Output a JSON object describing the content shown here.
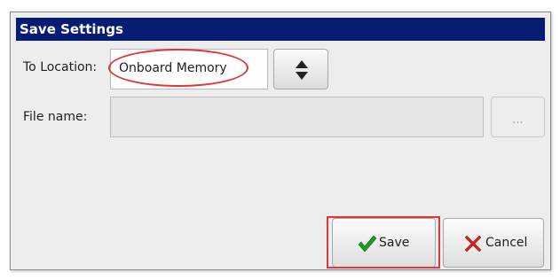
{
  "dialog": {
    "title": "Save Settings"
  },
  "location": {
    "label": "To Location:",
    "value": "Onboard Memory",
    "spin_icon": "up-down-arrows-icon"
  },
  "file": {
    "label": "File name:",
    "value": "",
    "browse_label": "..."
  },
  "actions": {
    "save_label": "Save",
    "save_icon": "checkmark-icon",
    "cancel_label": "Cancel",
    "cancel_icon": "x-mark-icon"
  },
  "colors": {
    "title_bar": "#071d73",
    "highlight": "#e0363a",
    "check_green": "#1e9a1e",
    "cancel_red": "#d61f1f"
  }
}
